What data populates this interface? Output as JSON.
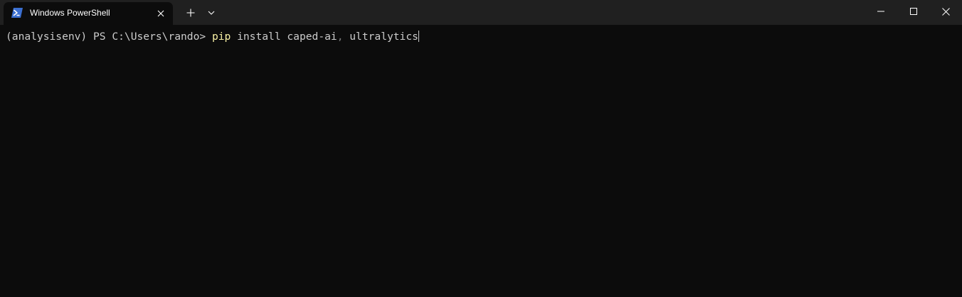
{
  "window": {
    "tab_title": "Windows PowerShell",
    "tab_icon": "powershell-icon",
    "buttons": {
      "new_tab": "plus-icon",
      "dropdown": "chevron-down-icon",
      "minimize": "minimize-icon",
      "maximize": "maximize-icon",
      "close": "close-icon"
    }
  },
  "terminal": {
    "prompt": "(analysisenv) PS C:\\Users\\rando> ",
    "command": "pip",
    "args_part1": " install caped-ai",
    "separator": ",",
    "args_part2": " ultralytics"
  },
  "colors": {
    "titlebar": "#202020",
    "terminal_bg": "#0c0c0c",
    "text": "#cccccc",
    "command": "#f9f1a5",
    "separator": "#767676",
    "icon_blue": "#3b6fd1"
  }
}
